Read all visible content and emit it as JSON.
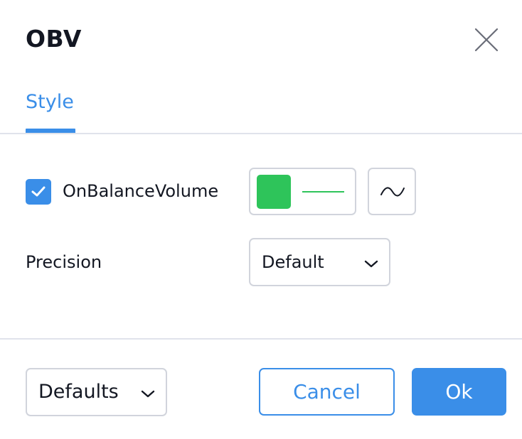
{
  "dialog": {
    "title": "OBV",
    "close_icon": "close-icon"
  },
  "tabs": [
    {
      "label": "Style",
      "active": true
    }
  ],
  "inputs": {
    "series": {
      "label": "OnBalanceVolume",
      "checked": true,
      "color": "#2ec45a",
      "line_style": "solid",
      "plot_type_icon": "line-wave-icon"
    },
    "precision": {
      "label": "Precision",
      "value": "Default"
    }
  },
  "footer": {
    "defaults_label": "Defaults",
    "cancel_label": "Cancel",
    "ok_label": "Ok"
  },
  "colors": {
    "accent": "#3a8ee8",
    "border": "#d1d4dc",
    "divider": "#e0e3eb",
    "text": "#131722"
  }
}
